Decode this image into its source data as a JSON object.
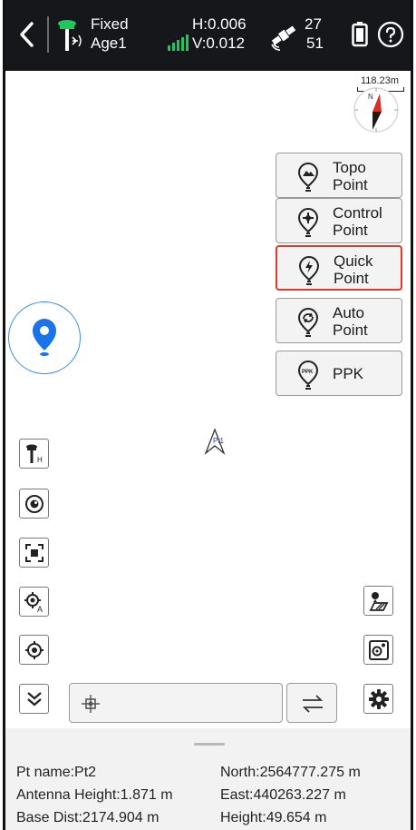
{
  "status": {
    "fix": "Fixed",
    "age": "Age1",
    "h_precision": "H:0.006",
    "v_precision": "V:0.012",
    "sats_used": "27",
    "sats_total": "51"
  },
  "map": {
    "scale": "118.23m",
    "compass_north": "N",
    "point_tag": "Pt1"
  },
  "point_buttons": [
    {
      "label": "Topo\nPoint",
      "icon": "topo-point-icon",
      "selected": false
    },
    {
      "label": "Control\nPoint",
      "icon": "control-point-icon",
      "selected": false
    },
    {
      "label": "Quick\nPoint",
      "icon": "quick-point-icon",
      "selected": true
    },
    {
      "label": "Auto\nPoint",
      "icon": "auto-point-icon",
      "selected": false
    },
    {
      "label": "PPK",
      "icon": "ppk-icon",
      "selected": false
    }
  ],
  "ppk_icon_text": "PPK",
  "tools_left": [
    "antenna-height-icon",
    "lens-icon",
    "zoom-extent-icon",
    "auto-locate-icon",
    "center-icon",
    "collapse-icon"
  ],
  "tools_right": [
    "layers-icon",
    "map-settings-icon",
    "settings-icon"
  ],
  "antenna_sub": "H",
  "autolocate_sub": "A",
  "info": {
    "pt_name": "Pt name:Pt2",
    "north": "North:2564777.275 m",
    "antenna_height": "Antenna Height:1.871 m",
    "east": "East:440263.227 m",
    "base_dist": "Base Dist:2174.904 m",
    "height": "Height:49.654 m"
  },
  "colors": {
    "accent_blue": "#1a73e8",
    "gps_green": "#22c55e",
    "selected_red": "#e0392b",
    "topbar": "#16171a"
  }
}
